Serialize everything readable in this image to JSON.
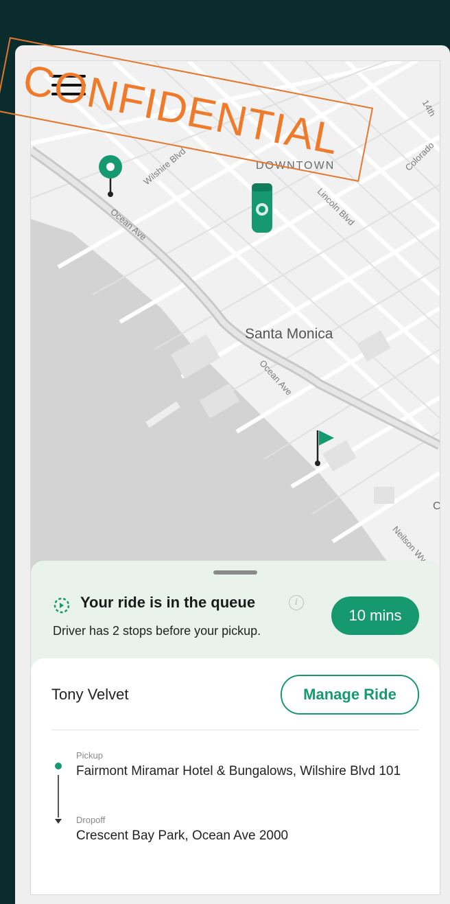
{
  "map": {
    "labels": {
      "downtown": "DOWNTOWN",
      "santa_monica": "Santa Monica",
      "wilshire": "Wilshire Blvd",
      "ocean1": "Ocean Ave",
      "lincoln": "Lincoln Blvd",
      "ocean2": "Ocean Ave",
      "colorado": "Colorado",
      "nielson": "Neilson Wy",
      "fourteen": "14th",
      "cutoff": "C"
    }
  },
  "watermark": {
    "text": "CONFIDENTIAL",
    "color": "#ee7a2a"
  },
  "status": {
    "title": "Your ride is in the queue",
    "subtitle": "Driver has 2 stops before your pickup.",
    "eta": "10 mins"
  },
  "ride": {
    "driver_name": "Tony Velvet",
    "manage_label": "Manage Ride",
    "pickup_label": "Pickup",
    "pickup_address": "Fairmont Miramar Hotel & Bungalows, Wilshire Blvd 101",
    "dropoff_label": "Dropoff",
    "dropoff_address": "Crescent Bay Park, Ocean Ave 2000"
  },
  "colors": {
    "accent": "#16996f",
    "sheet_bg": "#e9f3ec",
    "frame_bg": "#0a2c2c"
  },
  "icons": [
    "menu-icon",
    "pickup-pin-icon",
    "car-icon",
    "dropoff-flag-icon",
    "queue-clock-icon",
    "info-icon"
  ]
}
